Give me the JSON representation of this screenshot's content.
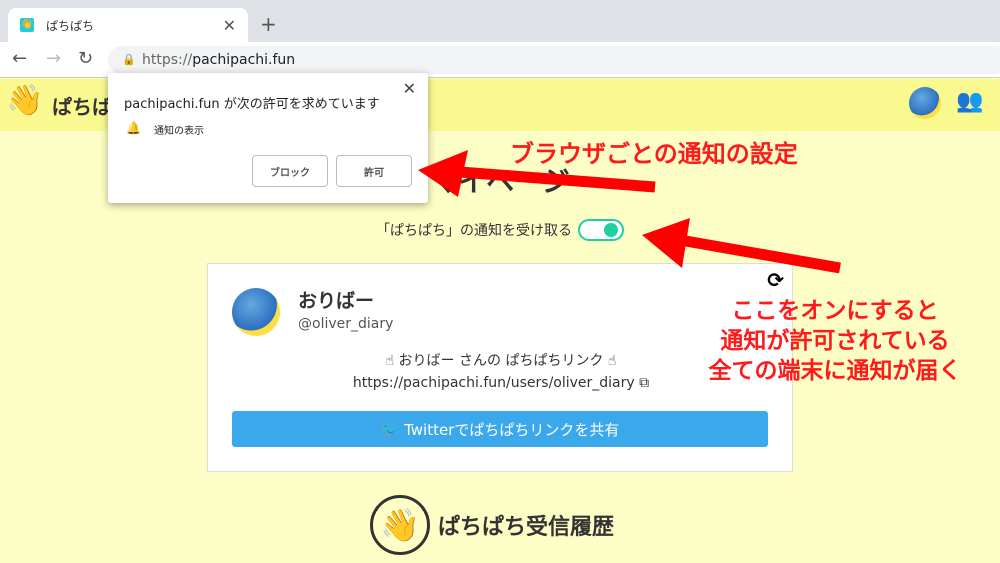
{
  "browser": {
    "tab_title": "ぱちぱち",
    "url_scheme": "https://",
    "url_host": "pachipachi.fun"
  },
  "header": {
    "brand": "ぱちぱち"
  },
  "page": {
    "title": "マイページ",
    "toggle_label": "「ぱちぱち」の通知を受け取る",
    "toggle_on": true
  },
  "card": {
    "name": "おりばー",
    "handle": "@oliver_diary",
    "link_label": "おりばー さんの ぱちぱちリンク",
    "link_url": "https://pachipachi.fun/users/oliver_diary",
    "share_button": "Twitterでぱちぱちリンクを共有"
  },
  "history": {
    "title": "ぱちぱち受信履歴"
  },
  "popup": {
    "title": "pachipachi.fun が次の許可を求めています",
    "permission": "通知の表示",
    "block": "ブロック",
    "allow": "許可"
  },
  "annotations": {
    "top": "ブラウザごとの通知の設定",
    "bottom_lines": [
      "ここをオンにすると",
      "通知が許可されている",
      "全ての端末に通知が届く"
    ]
  },
  "colors": {
    "accent": "#1dd1a1",
    "twitter": "#3ca8ec",
    "annotation": "#ff1a1a"
  }
}
